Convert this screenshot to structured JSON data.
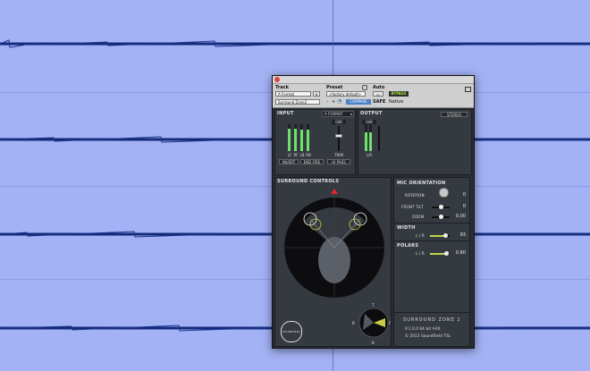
{
  "host": {
    "lanes": 4
  },
  "window": {
    "labels": {
      "track": "Track",
      "preset": "Preset",
      "auto": "Auto"
    },
    "track_name": "A Format",
    "track_menu": "Surround Zone2",
    "preset_value": "<factory default>",
    "compare_label": "COMPARE",
    "safe_label": "SAFE",
    "bypass_label": "BYPASS",
    "native_label": "Native",
    "dash_minus": "–",
    "dash_plus": "+",
    "track_btn": "a"
  },
  "input": {
    "title": "INPUT",
    "format": "A FORMAT",
    "gain_db": "0dB",
    "channels": [
      "LF",
      "RF",
      "LB",
      "RB"
    ],
    "meter_levels": [
      0.85,
      0.85,
      0.8,
      0.8
    ],
    "trim_label": "TRIM",
    "trim_level": 0.62,
    "buttons": {
      "invert": "INVERT",
      "endfire": "END FIRE",
      "hipass": "HI PASS"
    }
  },
  "output": {
    "title": "OUTPUT",
    "gain_db": "0dB",
    "channels_label": "L/R",
    "meter_levels": [
      0.7,
      0.7
    ],
    "mode": "STEREO"
  },
  "surround": {
    "title": "SURROUND CONTROLS",
    "logo": "SOUNDFIELD",
    "compass_letters": {
      "top": "T",
      "right": "F",
      "bottom": "B",
      "left": "B"
    }
  },
  "mic_orientation": {
    "title": "MIC ORIENTATION",
    "rows": [
      {
        "label": "ROTATION",
        "value": "0"
      },
      {
        "label": "FRONT TILT",
        "value": "0"
      },
      {
        "label": "ZOOM",
        "value": "0.00"
      }
    ]
  },
  "width": {
    "title": "WIDTH",
    "row_label": "L / R",
    "value": "93",
    "level": 0.75
  },
  "polars": {
    "title": "POLARS",
    "row_label": "L / R",
    "value": "0.80",
    "level": 0.8
  },
  "product": {
    "name": "SURROUND ZONE 2",
    "version": "V.1.0.0 64 bit AAX",
    "copyright": "© 2013 SoundField TSL"
  }
}
